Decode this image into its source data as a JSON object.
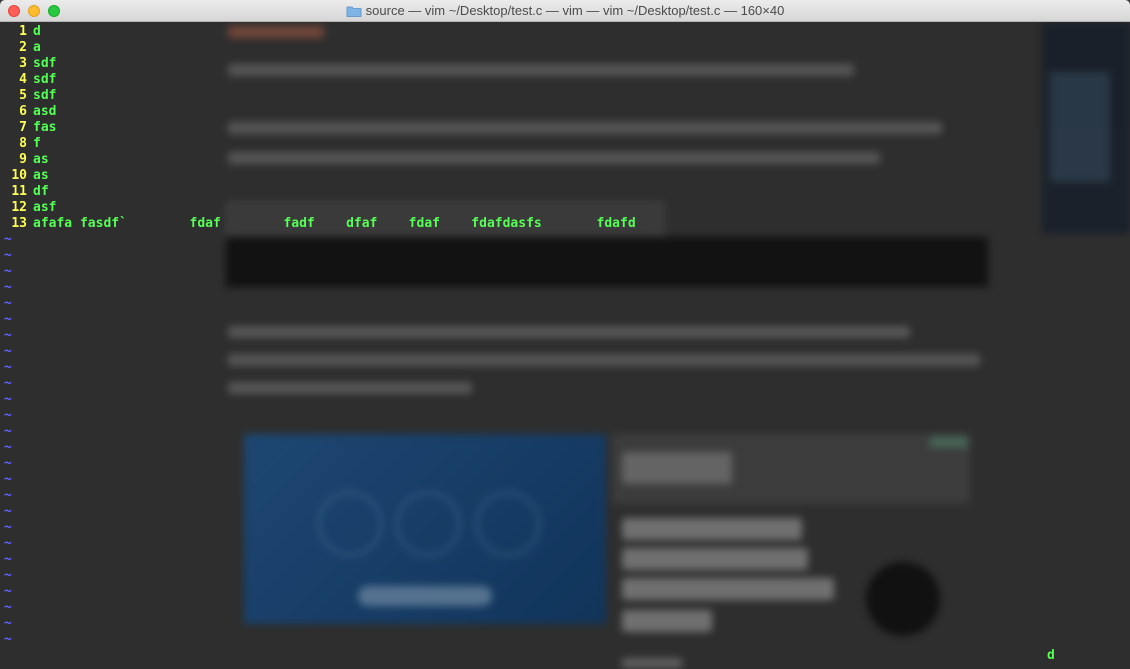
{
  "window": {
    "title": "source — vim ~/Desktop/test.c — vim — vim ~/Desktop/test.c — 160×40",
    "buttons": {
      "close": "close",
      "minimize": "minimize",
      "maximize": "zoom"
    }
  },
  "editor": {
    "lines": [
      {
        "num": "1",
        "text": "d"
      },
      {
        "num": "2",
        "text": "a"
      },
      {
        "num": "3",
        "text": "sdf"
      },
      {
        "num": "4",
        "text": "sdf"
      },
      {
        "num": "5",
        "text": "sdf"
      },
      {
        "num": "6",
        "text": "asd"
      },
      {
        "num": "7",
        "text": "fas"
      },
      {
        "num": "8",
        "text": "f"
      },
      {
        "num": "9",
        "text": "as"
      },
      {
        "num": "10",
        "text": "as"
      },
      {
        "num": "11",
        "text": "df"
      },
      {
        "num": "12",
        "text": "asf"
      },
      {
        "num": "13",
        "text": "afafa fasdf`        fdaf        fadf    dfaf    fdaf    fdafdasfs       fdafd"
      }
    ],
    "empty_line_marker": "~",
    "command_display": "d"
  },
  "colors": {
    "line_number": "#ffff55",
    "text": "#55ff55",
    "tilde": "#6060ff"
  },
  "icons": {
    "title_icon": "folder-icon"
  }
}
